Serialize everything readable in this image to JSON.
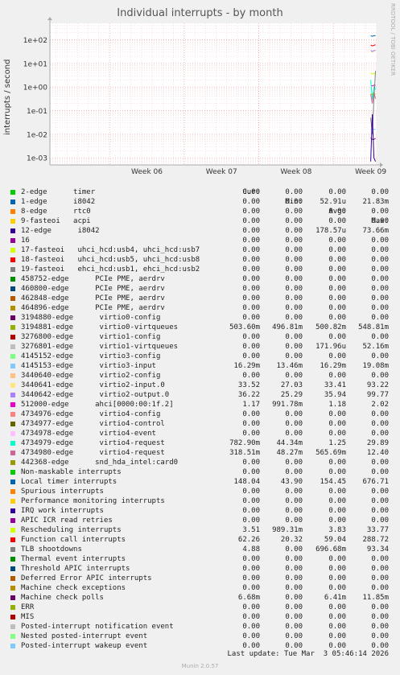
{
  "title": "Individual interrupts - by month",
  "ylabel": "interrupts / second",
  "rrdtool": "RRDTOOL / TOBI OETIKER",
  "legend_headers": {
    "cur": "Cur:",
    "min": "Min:",
    "avg": "Avg:",
    "max": "Max:"
  },
  "rows": [
    {
      "name": "2-edge      timer",
      "color": "#00cc00",
      "cur": "0.00",
      "min": "0.00",
      "avg": "0.00",
      "max": "0.00"
    },
    {
      "name": "1-edge      i8042",
      "color": "#0066b3",
      "cur": "0.00",
      "min": "0.00",
      "avg": "52.91u",
      "max": "21.83m"
    },
    {
      "name": "8-edge      rtc0",
      "color": "#ff8000",
      "cur": "0.00",
      "min": "0.00",
      "avg": "0.00",
      "max": "0.00"
    },
    {
      "name": "9-fasteoi   acpi",
      "color": "#ffcc00",
      "cur": "0.00",
      "min": "0.00",
      "avg": "0.00",
      "max": "0.00"
    },
    {
      "name": "12-edge      i8042",
      "color": "#330099",
      "cur": "0.00",
      "min": "0.00",
      "avg": "178.57u",
      "max": "73.66m"
    },
    {
      "name": "16",
      "color": "#990099",
      "cur": "0.00",
      "min": "0.00",
      "avg": "0.00",
      "max": "0.00"
    },
    {
      "name": "17-fasteoi   uhci_hcd:usb4, uhci_hcd:usb7",
      "color": "#ccff00",
      "cur": "0.00",
      "min": "0.00",
      "avg": "0.00",
      "max": "0.00"
    },
    {
      "name": "18-fasteoi   uhci_hcd:usb5, uhci_hcd:usb8",
      "color": "#ff0000",
      "cur": "0.00",
      "min": "0.00",
      "avg": "0.00",
      "max": "0.00"
    },
    {
      "name": "19-fasteoi   ehci_hcd:usb1, ehci_hcd:usb2",
      "color": "#808080",
      "cur": "0.00",
      "min": "0.00",
      "avg": "0.00",
      "max": "0.00"
    },
    {
      "name": "458752-edge      PCIe PME, aerdrv",
      "color": "#008f00",
      "cur": "0.00",
      "min": "0.00",
      "avg": "0.00",
      "max": "0.00"
    },
    {
      "name": "460800-edge      PCIe PME, aerdrv",
      "color": "#00487d",
      "cur": "0.00",
      "min": "0.00",
      "avg": "0.00",
      "max": "0.00"
    },
    {
      "name": "462848-edge      PCIe PME, aerdrv",
      "color": "#b35a00",
      "cur": "0.00",
      "min": "0.00",
      "avg": "0.00",
      "max": "0.00"
    },
    {
      "name": "464896-edge      PCIe PME, aerdrv",
      "color": "#b38f00",
      "cur": "0.00",
      "min": "0.00",
      "avg": "0.00",
      "max": "0.00"
    },
    {
      "name": "3194880-edge      virtio0-config",
      "color": "#6b006b",
      "cur": "0.00",
      "min": "0.00",
      "avg": "0.00",
      "max": "0.00"
    },
    {
      "name": "3194881-edge      virtio0-virtqueues",
      "color": "#8fb300",
      "cur": "503.60m",
      "min": "496.81m",
      "avg": "500.82m",
      "max": "548.81m"
    },
    {
      "name": "3276800-edge      virtio1-config",
      "color": "#b30000",
      "cur": "0.00",
      "min": "0.00",
      "avg": "0.00",
      "max": "0.00"
    },
    {
      "name": "3276801-edge      virtio1-virtqueues",
      "color": "#bebebe",
      "cur": "0.00",
      "min": "0.00",
      "avg": "171.96u",
      "max": "52.16m"
    },
    {
      "name": "4145152-edge      virtio3-config",
      "color": "#80ff80",
      "cur": "0.00",
      "min": "0.00",
      "avg": "0.00",
      "max": "0.00"
    },
    {
      "name": "4145153-edge      virtio3-input",
      "color": "#80c9ff",
      "cur": "16.29m",
      "min": "13.46m",
      "avg": "16.29m",
      "max": "19.08m"
    },
    {
      "name": "3440640-edge      virtio2-config",
      "color": "#ffc080",
      "cur": "0.00",
      "min": "0.00",
      "avg": "0.00",
      "max": "0.00"
    },
    {
      "name": "3440641-edge      virtio2-input.0",
      "color": "#ffe680",
      "cur": "33.52",
      "min": "27.03",
      "avg": "33.41",
      "max": "93.22"
    },
    {
      "name": "3440642-edge      virtio2-output.0",
      "color": "#aa80ff",
      "cur": "36.22",
      "min": "25.29",
      "avg": "35.94",
      "max": "99.77"
    },
    {
      "name": "512000-edge      ahci[0000:00:1f.2]",
      "color": "#ee00cc",
      "cur": "1.17",
      "min": "991.78m",
      "avg": "1.18",
      "max": "2.02"
    },
    {
      "name": "4734976-edge      virtio4-config",
      "color": "#ff8080",
      "cur": "0.00",
      "min": "0.00",
      "avg": "0.00",
      "max": "0.00"
    },
    {
      "name": "4734977-edge      virtio4-control",
      "color": "#666600",
      "cur": "0.00",
      "min": "0.00",
      "avg": "0.00",
      "max": "0.00"
    },
    {
      "name": "4734978-edge      virtio4-event",
      "color": "#ffbfff",
      "cur": "0.00",
      "min": "0.00",
      "avg": "0.00",
      "max": "0.00"
    },
    {
      "name": "4734979-edge      virtio4-request",
      "color": "#00ffcc",
      "cur": "782.90m",
      "min": "44.34m",
      "avg": "1.25",
      "max": "29.89"
    },
    {
      "name": "4734980-edge      virtio4-request",
      "color": "#cc6699",
      "cur": "318.51m",
      "min": "48.27m",
      "avg": "565.69m",
      "max": "12.40"
    },
    {
      "name": "442368-edge      snd_hda_intel:card0",
      "color": "#999900",
      "cur": "0.00",
      "min": "0.00",
      "avg": "0.00",
      "max": "0.00"
    },
    {
      "name": "Non-maskable interrupts",
      "color": "#00cc00",
      "cur": "0.00",
      "min": "0.00",
      "avg": "0.00",
      "max": "0.00"
    },
    {
      "name": "Local timer interrupts",
      "color": "#0066b3",
      "cur": "148.04",
      "min": "43.90",
      "avg": "154.45",
      "max": "676.71"
    },
    {
      "name": "Spurious interrupts",
      "color": "#ff8000",
      "cur": "0.00",
      "min": "0.00",
      "avg": "0.00",
      "max": "0.00"
    },
    {
      "name": "Performance monitoring interrupts",
      "color": "#ffcc00",
      "cur": "0.00",
      "min": "0.00",
      "avg": "0.00",
      "max": "0.00"
    },
    {
      "name": "IRQ work interrupts",
      "color": "#330099",
      "cur": "0.00",
      "min": "0.00",
      "avg": "0.00",
      "max": "0.00"
    },
    {
      "name": "APIC ICR read retries",
      "color": "#990099",
      "cur": "0.00",
      "min": "0.00",
      "avg": "0.00",
      "max": "0.00"
    },
    {
      "name": "Rescheduling interrupts",
      "color": "#ccff00",
      "cur": "3.51",
      "min": "989.31m",
      "avg": "3.83",
      "max": "33.77"
    },
    {
      "name": "Function call interrupts",
      "color": "#ff0000",
      "cur": "62.26",
      "min": "20.32",
      "avg": "59.04",
      "max": "288.72"
    },
    {
      "name": "TLB shootdowns",
      "color": "#808080",
      "cur": "4.88",
      "min": "0.00",
      "avg": "696.68m",
      "max": "93.34"
    },
    {
      "name": "Thermal event interrupts",
      "color": "#008f00",
      "cur": "0.00",
      "min": "0.00",
      "avg": "0.00",
      "max": "0.00"
    },
    {
      "name": "Threshold APIC interrupts",
      "color": "#00487d",
      "cur": "0.00",
      "min": "0.00",
      "avg": "0.00",
      "max": "0.00"
    },
    {
      "name": "Deferred Error APIC interrupts",
      "color": "#b35a00",
      "cur": "0.00",
      "min": "0.00",
      "avg": "0.00",
      "max": "0.00"
    },
    {
      "name": "Machine check exceptions",
      "color": "#b38f00",
      "cur": "0.00",
      "min": "0.00",
      "avg": "0.00",
      "max": "0.00"
    },
    {
      "name": "Machine check polls",
      "color": "#6b006b",
      "cur": "6.68m",
      "min": "0.00",
      "avg": "6.41m",
      "max": "11.85m"
    },
    {
      "name": "ERR",
      "color": "#8fb300",
      "cur": "0.00",
      "min": "0.00",
      "avg": "0.00",
      "max": "0.00"
    },
    {
      "name": "MIS",
      "color": "#b30000",
      "cur": "0.00",
      "min": "0.00",
      "avg": "0.00",
      "max": "0.00"
    },
    {
      "name": "Posted-interrupt notification event",
      "color": "#bebebe",
      "cur": "0.00",
      "min": "0.00",
      "avg": "0.00",
      "max": "0.00"
    },
    {
      "name": "Nested posted-interrupt event",
      "color": "#80ff80",
      "cur": "0.00",
      "min": "0.00",
      "avg": "0.00",
      "max": "0.00"
    },
    {
      "name": "Posted-interrupt wakeup event",
      "color": "#80c9ff",
      "cur": "0.00",
      "min": "0.00",
      "avg": "0.00",
      "max": "0.00"
    }
  ],
  "last_update": "Last update: Tue Mar  3 05:46:14 2026",
  "footer": "Munin 2.0.57",
  "chart_data": {
    "type": "line",
    "title": "Individual interrupts - by month",
    "ylabel": "interrupts / second",
    "y_scale": "log",
    "ylim": [
      0.0005,
      500
    ],
    "y_ticks": [
      "1e-03",
      "1e-02",
      "1e-01",
      "1e+00",
      "1e+01",
      "1e+02"
    ],
    "y_tick_values": [
      0.001,
      0.01,
      0.1,
      1,
      10,
      100
    ],
    "x_labels": [
      "Week 06",
      "Week 07",
      "Week 08",
      "Week 09"
    ],
    "x_label_positions": [
      6,
      7,
      8,
      9
    ],
    "xlim": [
      5.2,
      9.58
    ],
    "data_start_week": 9.5,
    "grid": true,
    "series": [
      {
        "name": "Local timer interrupts",
        "color": "#0066b3",
        "values": [
          150,
          140,
          150,
          148
        ]
      },
      {
        "name": "Function call interrupts",
        "color": "#ff0000",
        "values": [
          60,
          55,
          58,
          62
        ]
      },
      {
        "name": "3440641-edge      virtio2-input.0",
        "color": "#ffe680",
        "values": [
          34,
          30,
          33,
          33.5
        ]
      },
      {
        "name": "3440642-edge      virtio2-output.0",
        "color": "#aa80ff",
        "values": [
          36,
          32,
          35,
          36
        ]
      },
      {
        "name": "Rescheduling interrupts",
        "color": "#ccff00",
        "values": [
          4,
          3.5,
          3.8,
          3.5
        ]
      },
      {
        "name": "512000-edge      ahci[0000:00:1f.2]",
        "color": "#ee00cc",
        "values": [
          1.2,
          1.1,
          1.2,
          1.17
        ]
      },
      {
        "name": "4734979-edge      virtio4-request",
        "color": "#00ffcc",
        "values": [
          2,
          0.3,
          1.0,
          0.78
        ]
      },
      {
        "name": "4734980-edge      virtio4-request",
        "color": "#cc6699",
        "values": [
          0.5,
          0.2,
          0.6,
          0.32
        ]
      },
      {
        "name": "3194881-edge      virtio0-virtqueues",
        "color": "#8fb300",
        "values": [
          0.5,
          0.5,
          0.5,
          0.5
        ]
      },
      {
        "name": "TLB shootdowns",
        "color": "#808080",
        "values": [
          0.05,
          0.01,
          0.3,
          4.88
        ]
      },
      {
        "name": "4145153-edge      virtio3-input",
        "color": "#80c9ff",
        "values": [
          0.016,
          0.015,
          0.016,
          0.016
        ]
      },
      {
        "name": "Machine check polls",
        "color": "#6b006b",
        "values": [
          0.007,
          0.006,
          0.006,
          0.0067
        ]
      },
      {
        "name": "12-edge      i8042",
        "color": "#330099",
        "values": [
          0.0007,
          0.07,
          0.001,
          0.0007
        ]
      }
    ]
  }
}
